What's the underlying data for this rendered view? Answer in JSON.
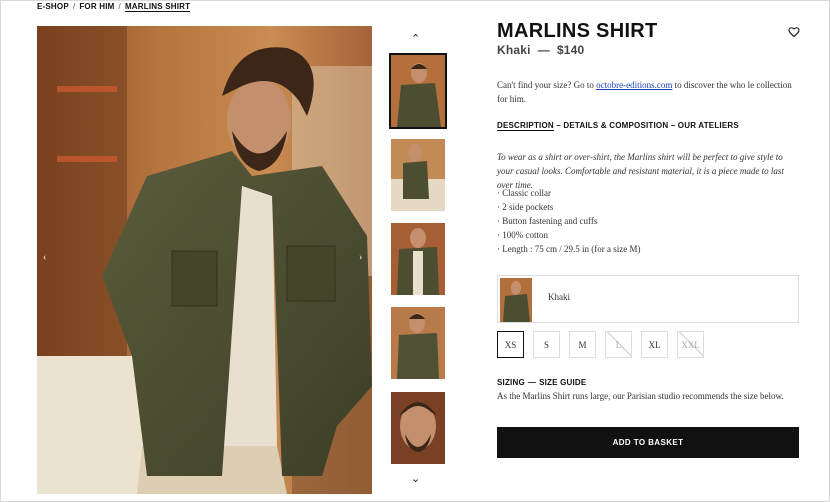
{
  "breadcrumb": {
    "items": [
      "E-SHOP",
      "FOR HIM",
      "MARLINS SHIRT"
    ],
    "separator": "/"
  },
  "gallery": {
    "main_image": "man-in-khaki-shirt-photo",
    "thumbnails": [
      "thumb-1",
      "thumb-2",
      "thumb-3",
      "thumb-4",
      "thumb-5"
    ],
    "active_index": 0,
    "prev_icon": "chevron-left-icon",
    "next_icon": "chevron-right-icon",
    "up_icon": "chevron-up-icon",
    "down_icon": "chevron-down-icon"
  },
  "product": {
    "title": "MARLINS SHIRT",
    "color": "Khaki",
    "dash": "—",
    "price": "$140",
    "favorite_icon": "heart-icon"
  },
  "size_hint": {
    "before": "Can't find your size? Go to ",
    "link": "octobre-editions.com",
    "after": " to discover the who le collection for him."
  },
  "tabs": {
    "description": "DESCRIPTION",
    "rest": " – DETAILS & COMPOSITION – OUR ATELIERS"
  },
  "description": "To wear as a shirt or over-shirt, the Marlins shirt will be perfect to give style to your casual looks. Comfortable and resistant material, it is a piece made to last over time.",
  "features": [
    "Classic collar",
    "2 side pockets",
    "Button fastening and cuffs",
    "100% cotton",
    "Length : 75 cm / 29.5 in (for a size M)"
  ],
  "color_option": {
    "label": "Khaki"
  },
  "sizes": [
    {
      "label": "XS",
      "state": "selected"
    },
    {
      "label": "S",
      "state": "available"
    },
    {
      "label": "M",
      "state": "available"
    },
    {
      "label": "L",
      "state": "unavailable"
    },
    {
      "label": "XL",
      "state": "available"
    },
    {
      "label": "XXL",
      "state": "unavailable"
    }
  ],
  "sizing": {
    "heading_a": "SIZING",
    "dash": "—",
    "heading_b": "SIZE GUIDE",
    "text": "As the Marlins Shirt runs large, our Parisian studio recommends the size below."
  },
  "cta": {
    "add_to_basket": "ADD TO BASKET"
  },
  "colors": {
    "khaki": "#55563a",
    "cta_bg": "#111111",
    "link": "#1a3fb8"
  }
}
